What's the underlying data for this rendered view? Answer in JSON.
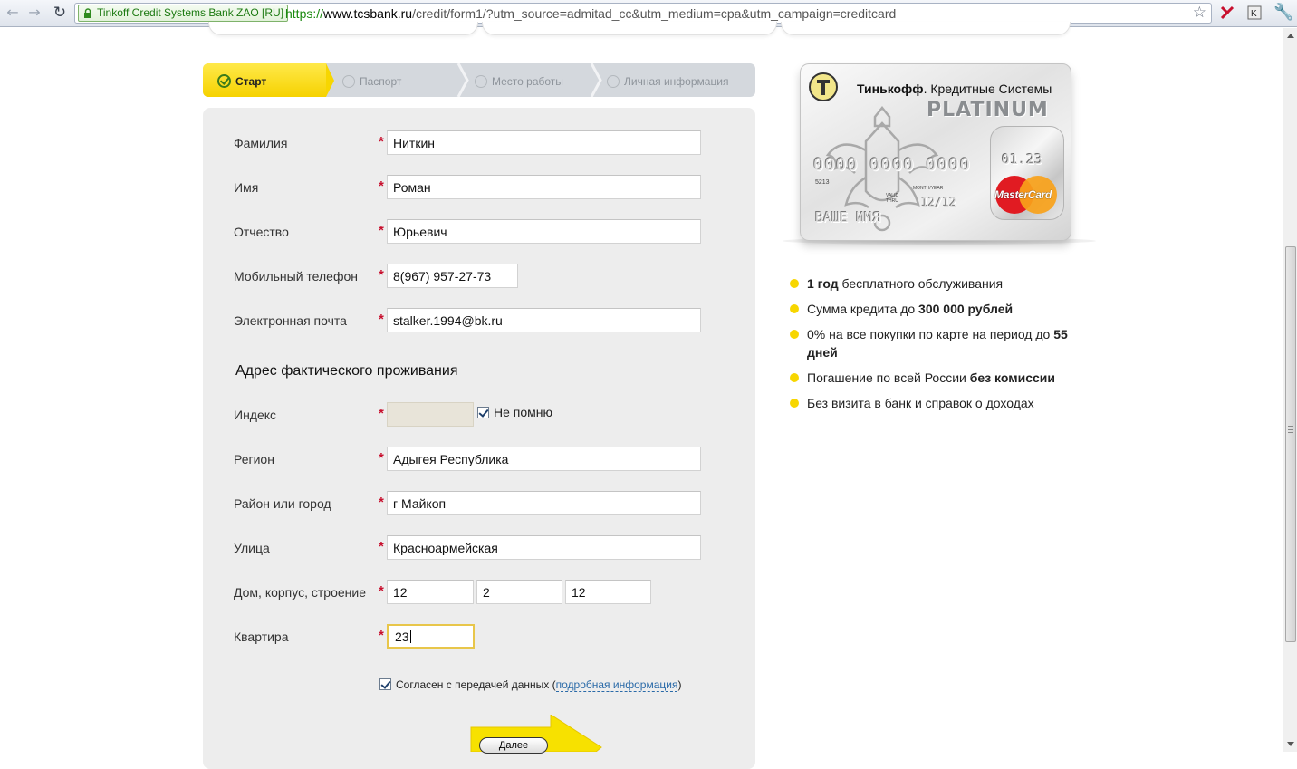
{
  "browser": {
    "ev_badge": "Tinkoff Credit Systems Bank ZAO [RU]",
    "url_scheme": "https://",
    "url_host": "www.tcsbank.ru",
    "url_path": "/credit/form1/?utm_source=admitad_cc&utm_medium=cpa&utm_campaign=creditcard"
  },
  "steps": [
    {
      "label": "Старт",
      "active": true
    },
    {
      "label": "Паспорт",
      "active": false
    },
    {
      "label": "Место работы",
      "active": false
    },
    {
      "label": "Личная информация",
      "active": false
    }
  ],
  "form": {
    "last_name": {
      "label": "Фамилия",
      "value": "Ниткин"
    },
    "first_name": {
      "label": "Имя",
      "value": "Роман"
    },
    "middle_name": {
      "label": "Отчество",
      "value": "Юрьевич"
    },
    "phone": {
      "label": "Мобильный телефон",
      "value": "8(967) 957-27-73"
    },
    "email": {
      "label": "Электронная почта",
      "value": "stalker.1994@bk.ru"
    },
    "required_mark": "*",
    "address_title": "Адрес фактического проживания",
    "index": {
      "label": "Индекс",
      "value": "",
      "dont_remember_label": "Не помню",
      "dont_remember_checked": true
    },
    "region": {
      "label": "Регион",
      "value": "Адыгея Республика"
    },
    "city": {
      "label": "Район или город",
      "value": "г Майкоп"
    },
    "street": {
      "label": "Улица",
      "value": "Красноармейская"
    },
    "house": {
      "label": "Дом, корпус, строение",
      "house": "12",
      "building": "2",
      "structure": "12"
    },
    "apartment": {
      "label": "Квартира",
      "value": "23"
    },
    "consent": {
      "text": "Согласен с передачей данных (",
      "link": "подробная информация",
      "close": ")",
      "checked": true
    },
    "next_button": "Далее"
  },
  "card": {
    "brand": "Тинькофф",
    "brand_rest": ". Кредитные Системы",
    "tier": "PLATINUM",
    "number": "0000 0000 0000",
    "number_prefix": "5213",
    "hologram_digits": "01.23",
    "valid_thru": "VALID\nTHRU",
    "month_year": "MONTH/YEAR",
    "expiry": "12/12",
    "holder": "ВАШЕ ИМЯ",
    "network": "MasterCard",
    "colors": {
      "mc_red": "#e11b22",
      "mc_orange": "#f9a21a"
    }
  },
  "benefits": [
    {
      "bold": "1 год",
      "rest": " бесплатного обслуживания"
    },
    {
      "pre": "Сумма кредита до ",
      "bold": "300 000 рублей"
    },
    {
      "pre": "0% на все покупки по карте на период до ",
      "bold": "55 дней"
    },
    {
      "pre": "Погашение по всей России ",
      "bold": "без комиссии"
    },
    {
      "pre": "Без визита в банк и справок о доходах"
    }
  ],
  "colors": {
    "accent_yellow": "#f7d600",
    "required_red": "#c8102e",
    "link_blue": "#2a6aa8"
  }
}
